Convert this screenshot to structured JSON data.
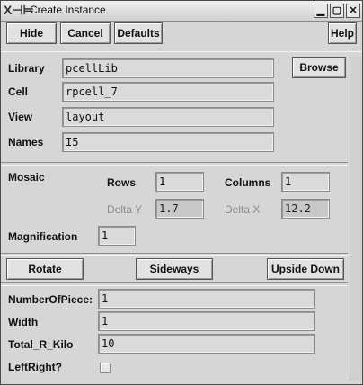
{
  "window": {
    "title": "Create Instance"
  },
  "toolbar": {
    "hide": "Hide",
    "cancel": "Cancel",
    "defaults": "Defaults",
    "help": "Help"
  },
  "fields": {
    "library_label": "Library",
    "library_value": "pcellLib",
    "browse": "Browse",
    "cell_label": "Cell",
    "cell_value": "rpcell_7",
    "view_label": "View",
    "view_value": "layout",
    "names_label": "Names",
    "names_value": "I5"
  },
  "mosaic": {
    "label": "Mosaic",
    "rows_label": "Rows",
    "rows_value": "1",
    "columns_label": "Columns",
    "columns_value": "1",
    "deltay_label": "Delta Y",
    "deltay_value": "1.7",
    "deltax_label": "Delta X",
    "deltax_value": "12.2",
    "magnification_label": "Magnification",
    "magnification_value": "1"
  },
  "actions": {
    "rotate": "Rotate",
    "sideways": "Sideways",
    "upside_down": "Upside Down"
  },
  "params": {
    "pieces_label": "NumberOfPiece:",
    "pieces_value": "1",
    "width_label": "Width",
    "width_value": "1",
    "rkilo_label": "Total_R_Kilo",
    "rkilo_value": "10",
    "leftright_label": "LeftRight?"
  }
}
